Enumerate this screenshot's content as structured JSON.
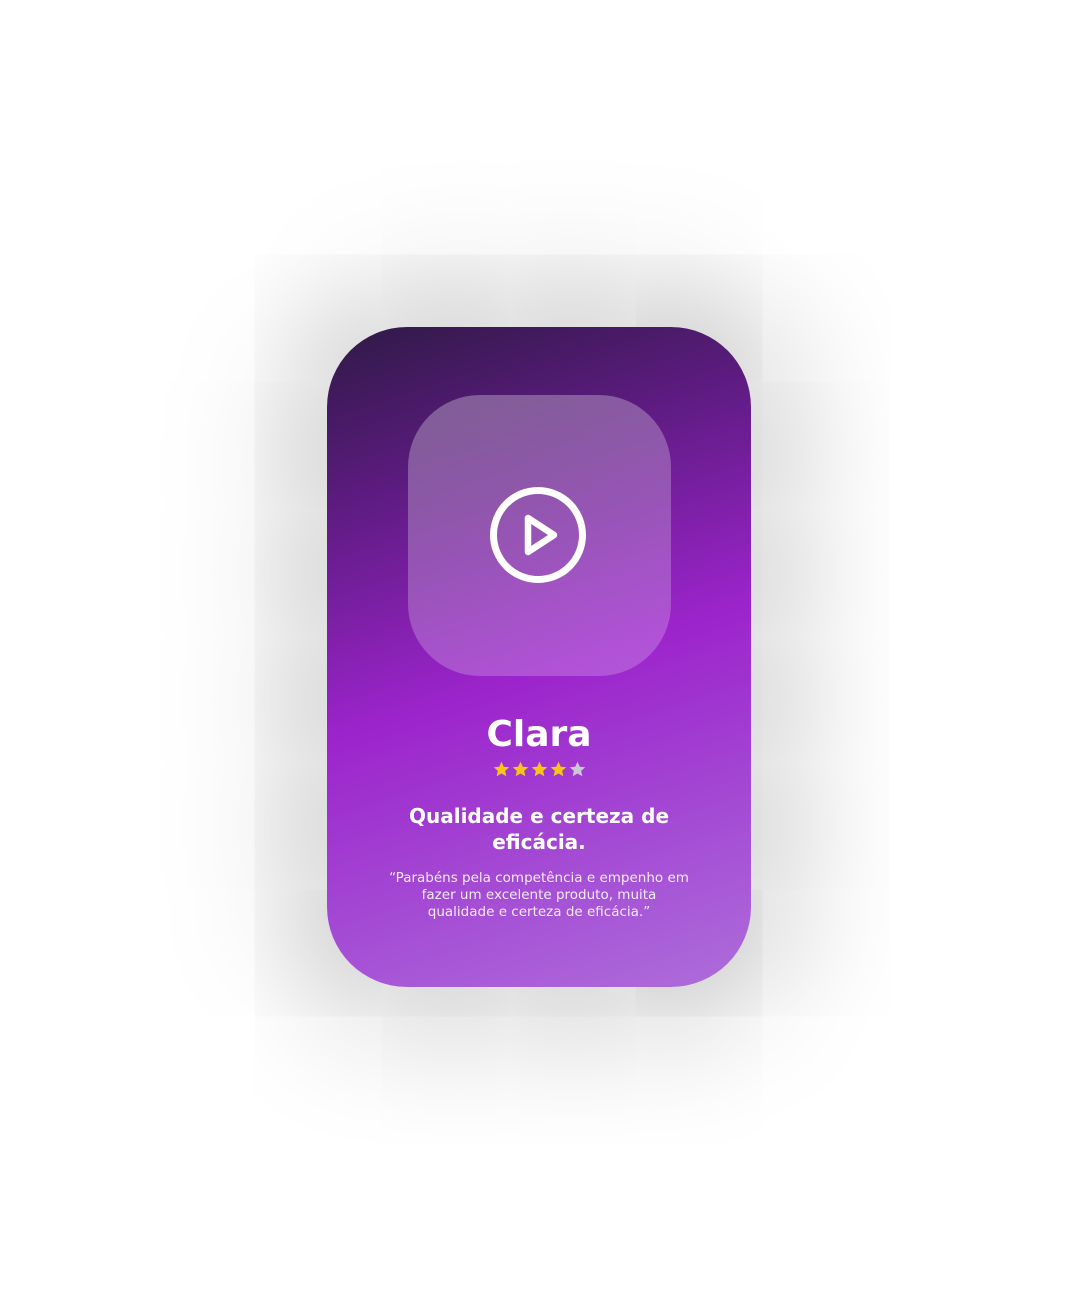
{
  "testimonial": {
    "video": {
      "icon": "play-circle-icon"
    },
    "name": "Clara",
    "rating": {
      "value": 4,
      "max": 5,
      "filled_color": "#F5C518",
      "empty_color": "#C9C9D6"
    },
    "headline": "Qualidade e certeza de eficácia.",
    "quote": "“Parabéns pela competência e empenho em fazer um excelente produto, muita qualidade e certeza de eficácia.”"
  },
  "colors": {
    "card_gradient": [
      "#2F1A46",
      "#5B1B7E",
      "#9C24CC",
      "#AE6DDA"
    ],
    "text": "#FFFFFF"
  }
}
